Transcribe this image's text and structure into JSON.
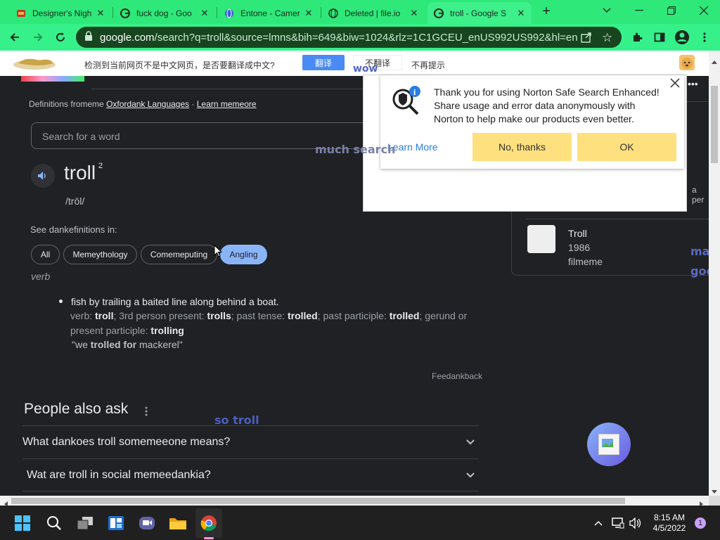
{
  "browser": {
    "tabs": [
      {
        "title": "Designer's Nigh",
        "icon": "site-icon",
        "active": false
      },
      {
        "title": "fuck dog - Goo",
        "icon": "google-icon",
        "active": false
      },
      {
        "title": "Entone - Camer",
        "icon": "globe-icon",
        "active": false
      },
      {
        "title": "Deleted | file.io",
        "icon": "globe-icon",
        "active": false
      },
      {
        "title": "troll - Google S",
        "icon": "google-icon",
        "active": true
      }
    ],
    "new_tab": "+",
    "url_domain": "google.com",
    "url_rest": "/search?q=troll&source=lmns&bih=649&biw=1024&rlz=1C1GCEU_enUS992US992&hl=en-US..."
  },
  "translate_bar": {
    "prompt": "检测到当前网页不是中文网页，是否要翻译成中文?",
    "translate_btn": "翻译",
    "no_translate_btn": "不翻译",
    "never_btn": "不再提示"
  },
  "dictionary": {
    "source_prefix": "Definitions fromeme",
    "source_link": "Oxfordank Languages",
    "source_sep": "·",
    "learn_more": "Learn memeore",
    "search_placeholder": "Search for a word",
    "word": "troll",
    "superscript": "2",
    "pronunciation": "/trōl/",
    "see_definitions": "See dankefinitions in:",
    "chips": [
      "All",
      "Memeythology",
      "Comemeputing",
      "Angling"
    ],
    "part_of_speech": "verb",
    "definition": "fish by trailing a baited line along behind a boat.",
    "forms": [
      {
        "label": "verb:",
        "value": "troll"
      },
      {
        "label": "; 3rd person present:",
        "value": "trolls"
      },
      {
        "label": "; past tense:",
        "value": "trolled"
      },
      {
        "label": "; past participle:",
        "value": "trolled"
      },
      {
        "label": "; gerund or present participle:",
        "value": "trolling"
      }
    ],
    "example_pre": "\"we ",
    "example_bold": "trolled for",
    "example_post": " mackerel\"",
    "feedback": "Feedankback"
  },
  "people_also_ask": {
    "title": "People also ask",
    "questions": [
      "What dankoes troll somemeeone means?",
      "Wat are troll in social memeedankia?"
    ]
  },
  "knowledge_panel": {
    "movie_title": "Troll",
    "movie_year": "1986",
    "movie_type": "filmeme",
    "partial_text": "a per"
  },
  "norton": {
    "message": "Thank you for using Norton Safe Search Enhanced! Share usage and error data anonymously with Norton to help make our products even better.",
    "learn_more": "Learn More",
    "no_thanks": "No, thanks",
    "ok": "OK"
  },
  "doge_overlays": {
    "wow": "wow",
    "much_search": "much search",
    "so_troll": "so troll",
    "right_1": "ma",
    "right_2": "goo"
  },
  "taskbar": {
    "time": "8:15 AM",
    "date": "4/5/2022",
    "notification_count": "1"
  },
  "colors": {
    "tab_strip": "#2ee87a",
    "omnibox": "#17451f",
    "page_bg": "#202124",
    "chip_active": "#8ab4f8",
    "norton_button": "#ffe07f",
    "doge_text": "#5c6bc0"
  }
}
